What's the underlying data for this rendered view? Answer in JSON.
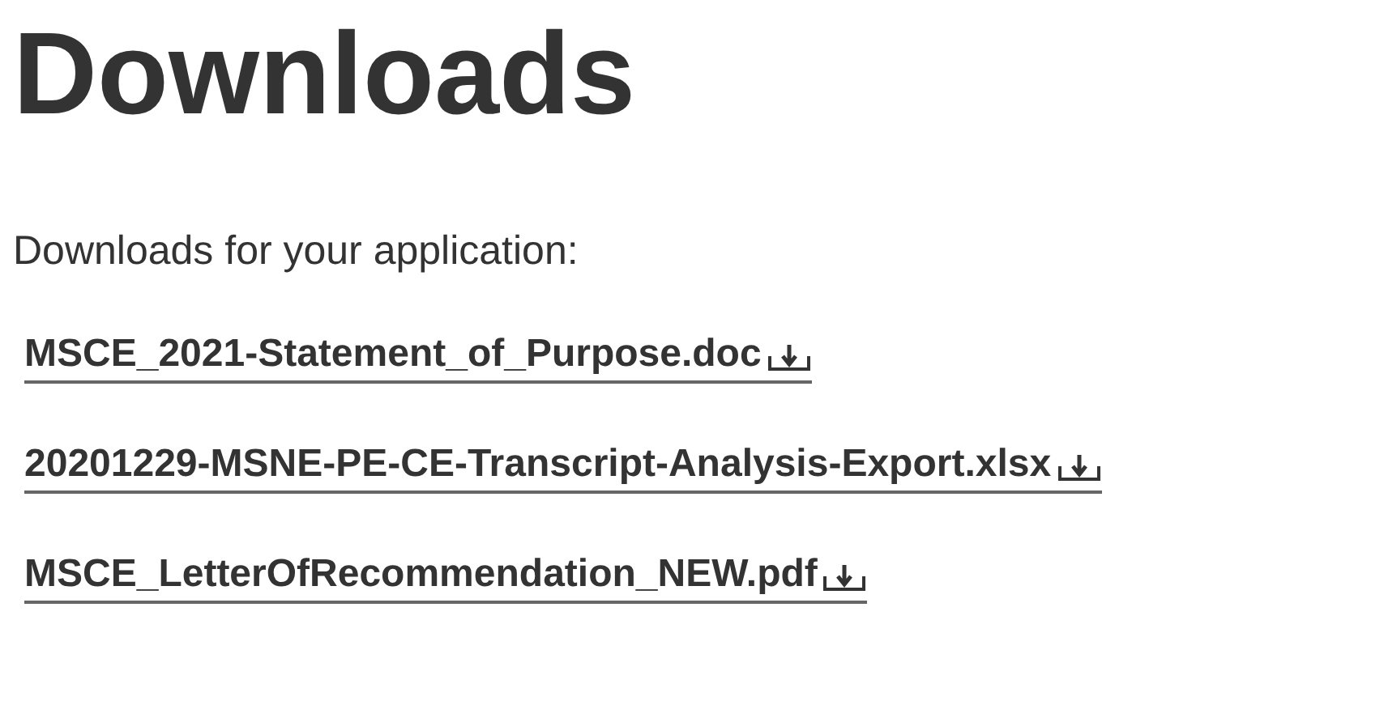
{
  "heading": "Downloads",
  "intro": "Downloads for your application:",
  "files": [
    {
      "name": "MSCE_2021-Statement_of_Purpose.doc"
    },
    {
      "name": "20201229-MSNE-PE-CE-Transcript-Analysis-Export.xlsx"
    },
    {
      "name": "MSCE_LetterOfRecommendation_NEW.pdf"
    }
  ]
}
